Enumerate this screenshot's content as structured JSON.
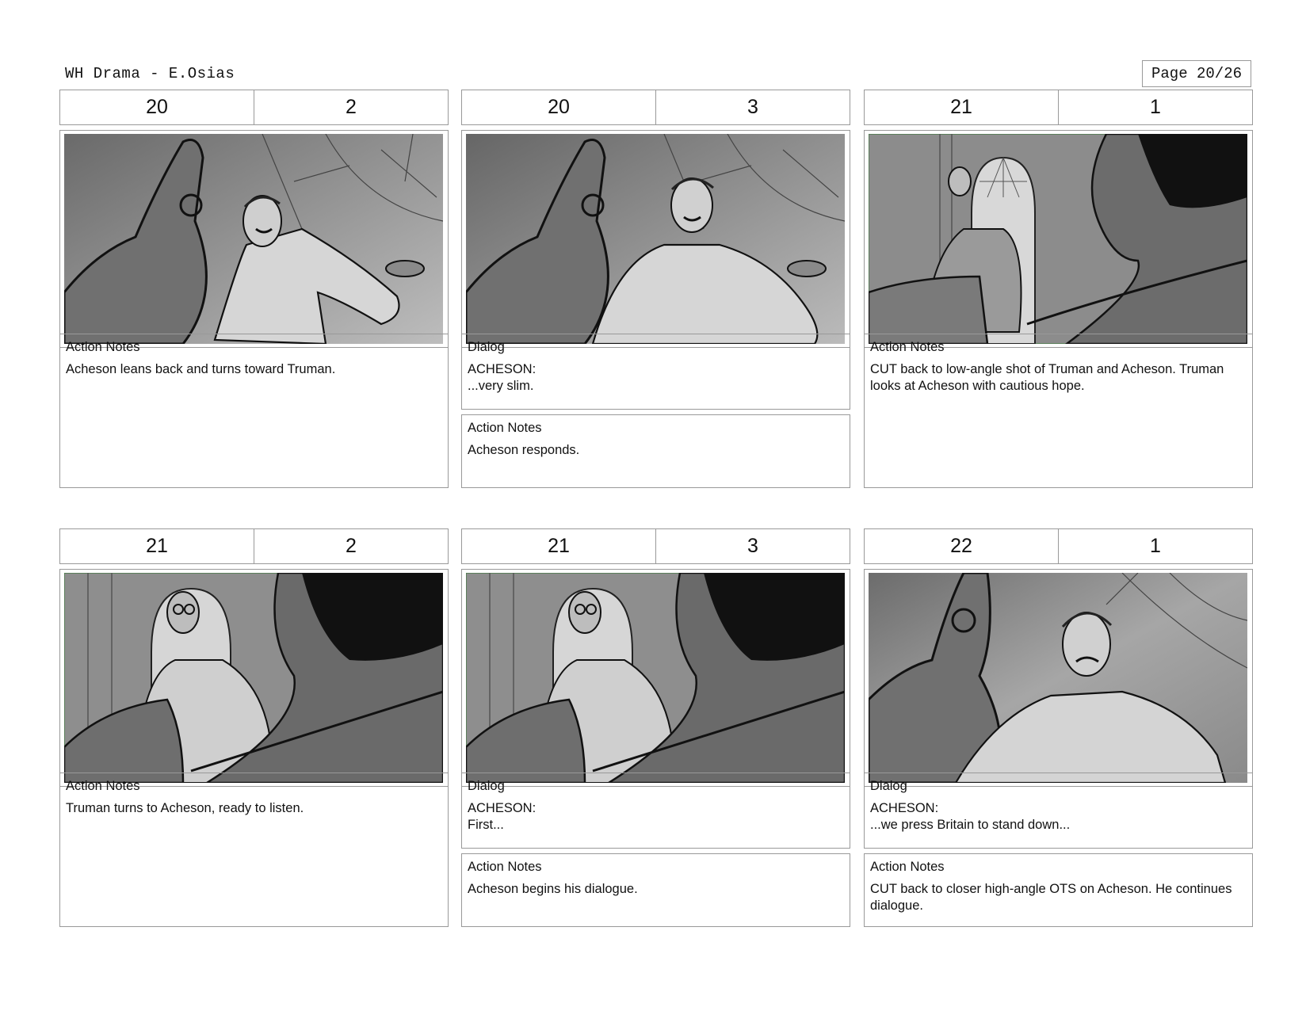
{
  "header": {
    "title": "WH Drama - E.Osias",
    "page": "Page 20/26"
  },
  "panels": [
    {
      "scene": "20",
      "shot": "2",
      "notes": [
        {
          "label": "Action Notes",
          "text": "Acheson leans back and turns toward Truman."
        }
      ]
    },
    {
      "scene": "20",
      "shot": "3",
      "notes": [
        {
          "label": "Dialog",
          "text": "ACHESON:\n...very slim."
        },
        {
          "label": "Action Notes",
          "text": "Acheson responds."
        }
      ]
    },
    {
      "scene": "21",
      "shot": "1",
      "notes": [
        {
          "label": "Action Notes",
          "text": "CUT back to low-angle shot of Truman and Acheson. Truman looks at Acheson with cautious hope."
        }
      ]
    },
    {
      "scene": "21",
      "shot": "2",
      "notes": [
        {
          "label": "Action Notes",
          "text": "Truman turns to Acheson, ready to listen."
        }
      ]
    },
    {
      "scene": "21",
      "shot": "3",
      "notes": [
        {
          "label": "Dialog",
          "text": "ACHESON:\nFirst..."
        },
        {
          "label": "Action Notes",
          "text": "Acheson begins his dialogue."
        }
      ]
    },
    {
      "scene": "22",
      "shot": "1",
      "notes": [
        {
          "label": "Dialog",
          "text": "ACHESON:\n...we press Britain to stand down..."
        },
        {
          "label": "Action Notes",
          "text": "CUT back to closer high-angle OTS on Acheson. He continues dialogue."
        }
      ]
    }
  ]
}
